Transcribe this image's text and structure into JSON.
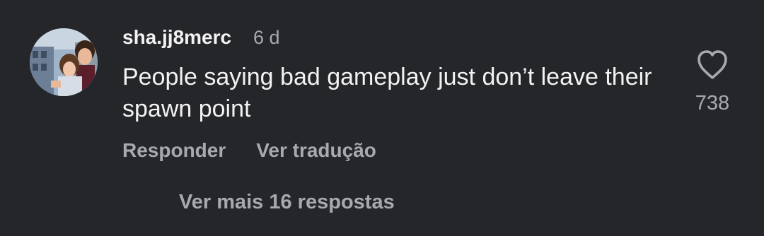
{
  "comment": {
    "avatar_icon": "profile-photo-avatar",
    "username": "sha.jj8merc",
    "timestamp": "6 d",
    "text": "People saying bad gameplay just don’t leave their spawn point",
    "like_icon": "heart-outline-icon",
    "like_count": "738",
    "reply_label": "Responder",
    "translate_label": "Ver tradução"
  },
  "replies": {
    "view_more_label": "Ver mais 16 respostas"
  },
  "colors": {
    "background": "#25262a",
    "primary_text": "#f2f2f2",
    "secondary_text": "#a8a9ad"
  }
}
